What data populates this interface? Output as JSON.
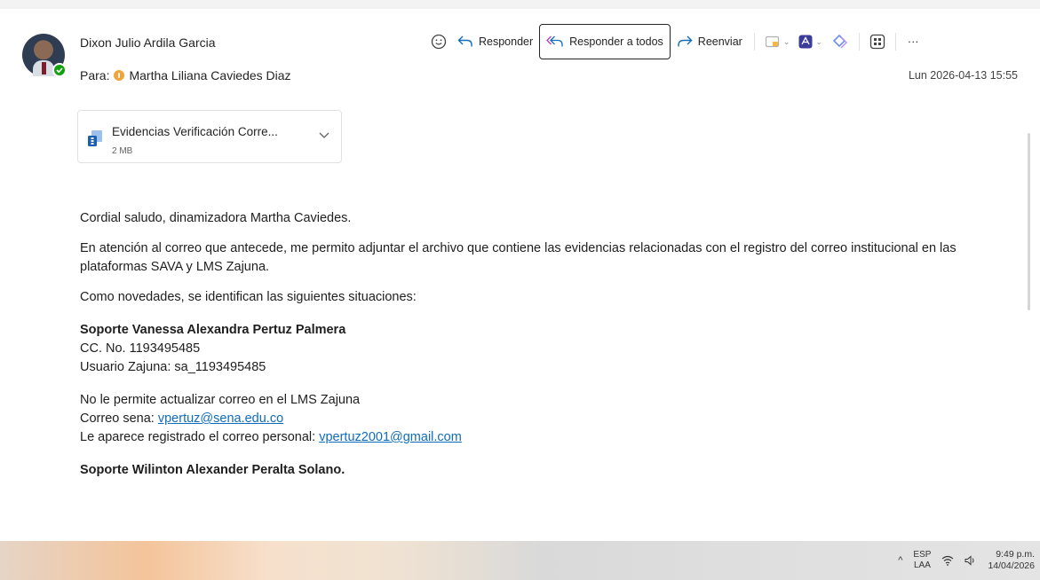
{
  "email": {
    "sender_name": "Dixon Julio Ardila Garcia",
    "to_label": "Para:",
    "to_name": "Martha Liliana Caviedes Diaz",
    "timestamp": "Lun 2026-04-13 15:55"
  },
  "toolbar": {
    "reply": "Responder",
    "reply_all": "Responder a todos",
    "forward": "Reenviar",
    "more": "···"
  },
  "attachment": {
    "name": "Evidencias Verificación Corre...",
    "size": "2 MB"
  },
  "body": {
    "greeting": "Cordial saludo, dinamizadora Martha Caviedes.",
    "paragraph1": "En atención al correo que antecede, me permito adjuntar el archivo que contiene las evidencias relacionadas con el registro del correo institucional en las plataformas SAVA y LMS Zajuna.",
    "paragraph2": "Como novedades, se identifican las siguientes situaciones:",
    "case1_title": "Soporte Vanessa Alexandra Pertuz Palmera",
    "case1_cc": "CC. No. 1193495485",
    "case1_user": "Usuario Zajuna: sa_1193495485",
    "case1_issue": "No le permite actualizar correo en el LMS Zajuna",
    "case1_sena_label": "Correo sena: ",
    "case1_sena_email": "vpertuz@sena.edu.co",
    "case1_personal_label": "Le aparece registrado el correo personal: ",
    "case1_personal_email": "vpertuz2001@gmail.com",
    "case2_title": "Soporte Wilinton Alexander Peralta Solano."
  },
  "taskbar": {
    "lang_top": "ESP",
    "lang_bottom": "LAA",
    "time": "9:49 p.m.",
    "date": "14/04/2026"
  },
  "colors": {
    "link": "#0f6cbd",
    "presence": "#13a10e",
    "pdf_red": "#c50f1f",
    "accent_blue": "#0f6cbd"
  }
}
